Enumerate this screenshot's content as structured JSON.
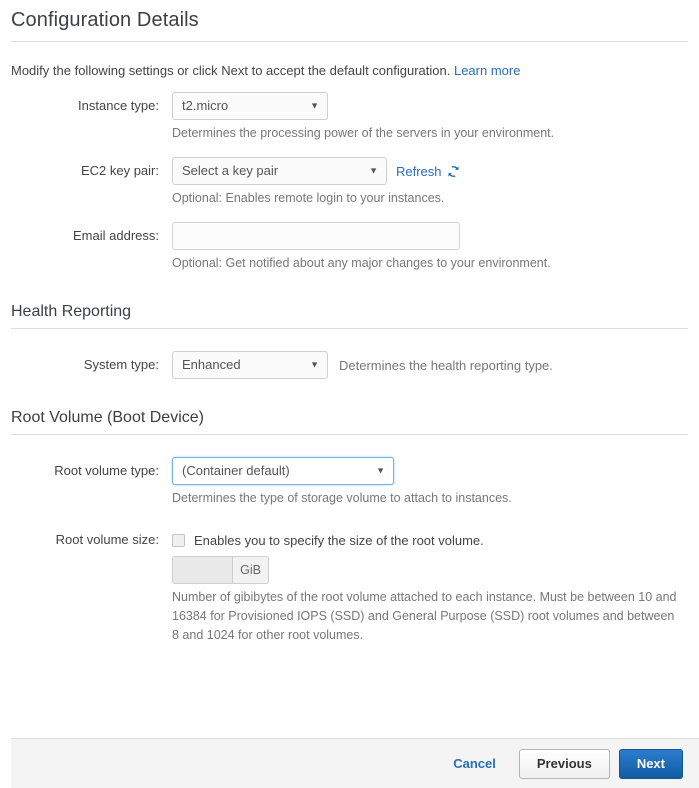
{
  "page": {
    "title": "Configuration Details",
    "intro_text": "Modify the following settings or click Next to accept the default configuration.",
    "learn_more_label": "Learn more"
  },
  "instance_type": {
    "label": "Instance type:",
    "value": "t2.micro",
    "help": "Determines the processing power of the servers in your environment."
  },
  "ec2_key_pair": {
    "label": "EC2 key pair:",
    "value": "Select a key pair",
    "refresh_label": "Refresh",
    "refresh_icon": "refresh-circular-arrows-icon",
    "help": "Optional: Enables remote login to your instances."
  },
  "email_address": {
    "label": "Email address:",
    "value": "",
    "placeholder": "",
    "help": "Optional: Get notified about any major changes to your environment."
  },
  "health_reporting": {
    "heading": "Health Reporting",
    "system_type": {
      "label": "System type:",
      "value": "Enhanced",
      "help": "Determines the health reporting type."
    }
  },
  "root_volume": {
    "heading": "Root Volume (Boot Device)",
    "volume_type": {
      "label": "Root volume type:",
      "value": "(Container default)",
      "help": "Determines the type of storage volume to attach to instances."
    },
    "volume_size": {
      "label": "Root volume size:",
      "checkbox_label": "Enables you to specify the size of the root volume.",
      "checked": false,
      "value": "",
      "unit": "GiB",
      "help": "Number of gibibytes of the root volume attached to each instance. Must be between 10 and 16384 for Provisioned IOPS (SSD) and General Purpose (SSD) root volumes and between 8 and 1024 for other root volumes."
    }
  },
  "footer": {
    "cancel_label": "Cancel",
    "previous_label": "Previous",
    "next_label": "Next"
  },
  "colors": {
    "link_blue": "#2a6ebb",
    "primary_button_blue": "#1a6bb5",
    "focus_border_blue": "#7ab0e8",
    "heading_gray": "#3c4043",
    "help_text_gray": "#777777"
  },
  "icons": {
    "caret_down": "▼"
  }
}
